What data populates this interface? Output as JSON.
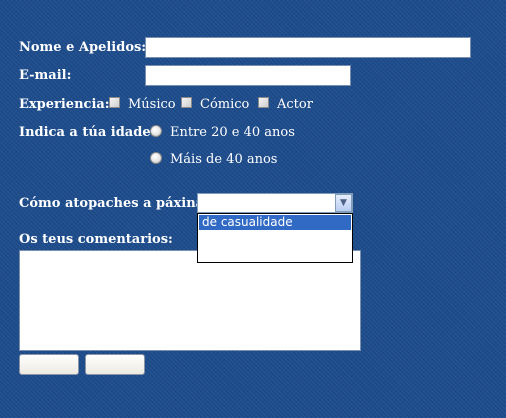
{
  "form": {
    "name": {
      "label": "Nome e Apelidos:",
      "value": ""
    },
    "email": {
      "label": "E-mail:",
      "value": ""
    },
    "experience": {
      "label": "Experiencia:",
      "options": [
        {
          "label": "Músico",
          "checked": false
        },
        {
          "label": "Cómico",
          "checked": false
        },
        {
          "label": "Actor",
          "checked": false
        }
      ]
    },
    "age": {
      "label": "Indica a túa idade:",
      "options": [
        {
          "label": "Entre 20 e 40 anos",
          "selected": false
        },
        {
          "label": "Máis de 40 anos",
          "selected": false
        }
      ]
    },
    "source": {
      "label": "Cómo atopaches a páxina:",
      "selected_value": "",
      "options": [
        "de casualidade"
      ],
      "highlighted": "de casualidade"
    },
    "comments": {
      "label": "Os teus comentarios:",
      "value": ""
    },
    "buttons": {
      "submit_label": "",
      "reset_label": ""
    }
  },
  "colors": {
    "background": "#1d4c8c",
    "highlight": "#316ac5",
    "label_text": "#ffffff"
  }
}
